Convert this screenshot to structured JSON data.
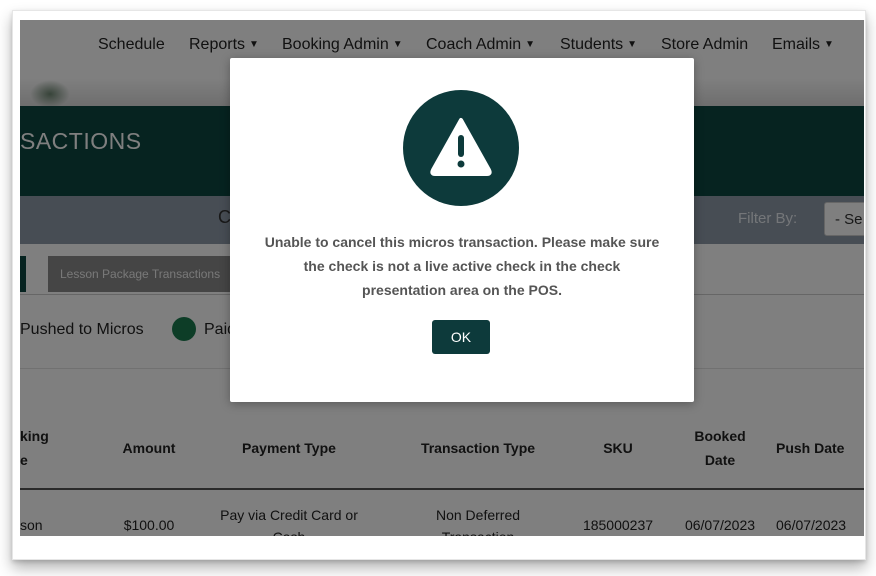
{
  "nav": {
    "items": [
      {
        "label": "Schedule",
        "dropdown": false
      },
      {
        "label": "Reports",
        "dropdown": true
      },
      {
        "label": "Booking Admin",
        "dropdown": true
      },
      {
        "label": "Coach Admin",
        "dropdown": true
      },
      {
        "label": "Students",
        "dropdown": true
      },
      {
        "label": "Store Admin",
        "dropdown": false
      },
      {
        "label": "Emails",
        "dropdown": true
      }
    ],
    "caret": "▼"
  },
  "banner": {
    "title": "SACTIONS"
  },
  "filter": {
    "partial_label": "C",
    "label": "Filter By:",
    "select_value": "- Se"
  },
  "tabs": {
    "lesson_package_label": "Lesson Package Transactions"
  },
  "legend": {
    "pushed_label": "Pushed to Micros",
    "paid_label": "Paid",
    "paid_color": "#1b7a4e"
  },
  "table": {
    "headers": {
      "booking": "king\ne",
      "amount": "Amount",
      "payment_type": "Payment Type",
      "transaction_type": "Transaction Type",
      "sku": "SKU",
      "booked_date": "Booked\nDate",
      "push_date": "Push Date"
    },
    "rows": [
      {
        "booking": "son",
        "amount": "$100.00",
        "payment_type": "Pay via Credit Card or\nCash",
        "transaction_type": "Non Deferred\nTransaction",
        "sku": "185000237",
        "booked_date": "06/07/2023",
        "push_date": "06/07/2023"
      }
    ]
  },
  "modal": {
    "icon": "warning-icon",
    "message": "Unable to cancel this micros transaction. Please make sure the check is not a live active check in the check presentation area on the POS.",
    "ok_label": "OK"
  },
  "colors": {
    "brand": "#0d4640",
    "modal_accent": "#0d3a3b"
  }
}
